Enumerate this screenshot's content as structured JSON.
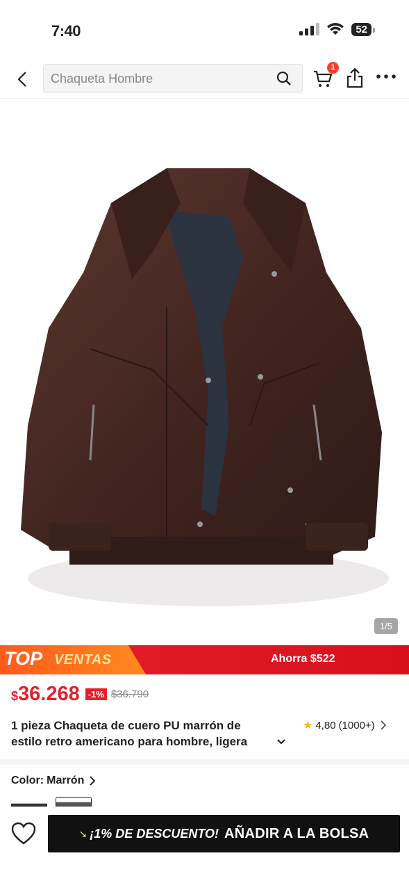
{
  "status_bar": {
    "time": "7:40",
    "battery": "52"
  },
  "nav": {
    "search_placeholder": "Chaqueta Hombre",
    "cart_count": "1"
  },
  "gallery": {
    "counter": "1/5"
  },
  "banner": {
    "top": "TOP",
    "ventas": "VENTAS",
    "savings": "Ahorra $522"
  },
  "price": {
    "currency": "$",
    "current": "36.268",
    "discount": "-1%",
    "original": "$36.790"
  },
  "product": {
    "title_line1": "1 pieza Chaqueta de cuero PU marrón de",
    "title_line2": "estilo retro americano para hombre, ligera",
    "rating": "4,80",
    "reviews": "(1000+)"
  },
  "color": {
    "label": "Color:",
    "value": "Marrón"
  },
  "bottom": {
    "promo": "¡1% DE DESCUENTO!",
    "add_to_bag": "AÑADIR A LA BOLSA"
  },
  "colors": {
    "accent": "#e4202b",
    "banner_orange": "#ff6a1e",
    "star": "#f6b800",
    "cta": "#111111",
    "jacket": "#4a2a24"
  }
}
